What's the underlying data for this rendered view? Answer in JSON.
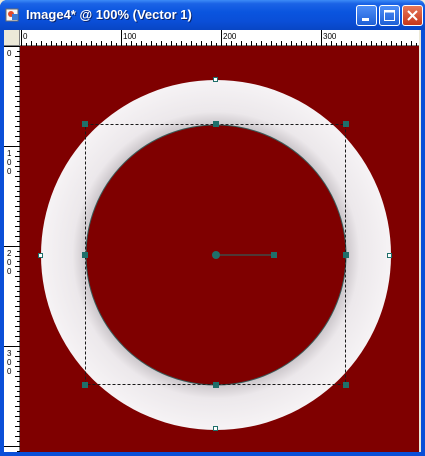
{
  "window": {
    "title": "Image4* @ 100% (Vector 1)",
    "app_icon": "image-document-icon",
    "buttons": [
      "minimize-icon",
      "maximize-icon",
      "close-icon"
    ]
  },
  "ruler_h": {
    "labels": [
      "0",
      "100",
      "200",
      "300"
    ]
  },
  "ruler_v": {
    "labels": [
      "0",
      "100",
      "200",
      "300"
    ]
  },
  "canvas": {
    "background_color": "#7f0000",
    "ring_color": "#f3eff1",
    "selection_color": "#1f6f6a"
  }
}
